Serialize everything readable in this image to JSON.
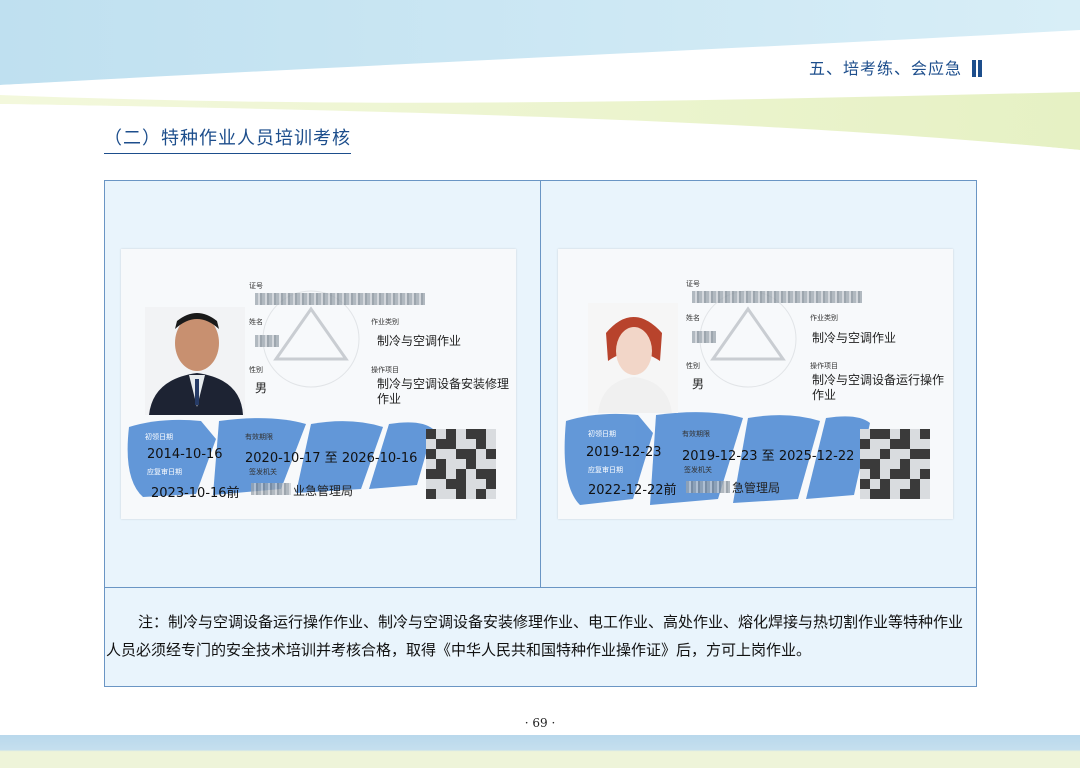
{
  "header": {
    "chapter": "五、培考练、会应急",
    "section_title": "（二）特种作业人员培训考核"
  },
  "cards": [
    {
      "label_cert_no": "证号",
      "label_name": "姓名",
      "label_gender": "性别",
      "gender": "男",
      "label_category": "作业类别",
      "category": "制冷与空调作业",
      "label_project": "操作项目",
      "project": "制冷与空调设备安装修理作业",
      "label_first_issue": "初领日期",
      "first_issue": "2014-10-16",
      "label_validity": "有效期限",
      "validity": "2020-10-17 至 2026-10-16",
      "label_review": "应复审日期",
      "review": "2023-10-16前",
      "label_authority": "签发机关",
      "authority": "业急管理局"
    },
    {
      "label_cert_no": "证号",
      "label_name": "姓名",
      "label_gender": "性别",
      "gender": "男",
      "label_category": "作业类别",
      "category": "制冷与空调作业",
      "label_project": "操作项目",
      "project": "制冷与空调设备运行操作作业",
      "label_first_issue": "初领日期",
      "first_issue": "2019-12-23",
      "label_validity": "有效期限",
      "validity": "2019-12-23 至 2025-12-22",
      "label_review": "应复审日期",
      "review": "2022-12-22前",
      "label_authority": "签发机关",
      "authority": "急管理局"
    }
  ],
  "note": "注：制冷与空调设备运行操作作业、制冷与空调设备安装修理作业、电工作业、高处作业、熔化焊接与热切割作业等特种作业人员必须经专门的安全技术培训并考核合格，取得《中华人民共和国特种作业操作证》后，方可上岗作业。",
  "page_number": "· 69 ·",
  "colors": {
    "accent": "#1d4e8c",
    "frame_border": "#6a95c4",
    "frame_bg": "#e9f4fc",
    "watermark_blue": "#3d7fd0"
  }
}
